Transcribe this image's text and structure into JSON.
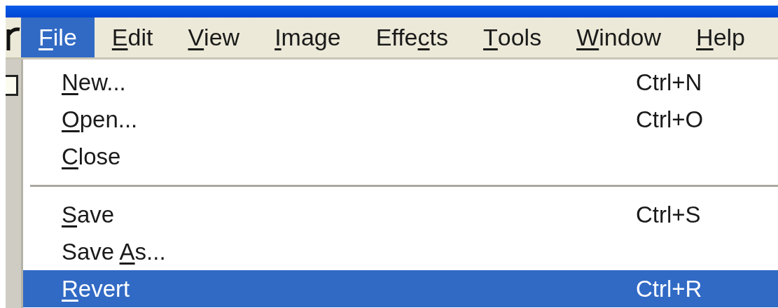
{
  "menu_bar": {
    "items": [
      {
        "key": "F",
        "after": "ile",
        "selected": true
      },
      {
        "key": "E",
        "after": "dit",
        "selected": false
      },
      {
        "key": "V",
        "after": "iew",
        "selected": false
      },
      {
        "key": "I",
        "after": "mage",
        "selected": false
      },
      {
        "before": "Effe",
        "key": "c",
        "after": "ts",
        "selected": false
      },
      {
        "key": "T",
        "after": "ools",
        "selected": false
      },
      {
        "key": "W",
        "after": "indow",
        "selected": false
      },
      {
        "key": "H",
        "after": "elp",
        "selected": false
      }
    ]
  },
  "file_menu": {
    "items": [
      {
        "kind": "item",
        "key": "N",
        "after": "ew...",
        "shortcut": "Ctrl+N",
        "selected": false
      },
      {
        "kind": "item",
        "key": "O",
        "after": "pen...",
        "shortcut": "Ctrl+O",
        "selected": false
      },
      {
        "kind": "item",
        "key": "C",
        "after": "lose",
        "selected": false
      },
      {
        "kind": "separator"
      },
      {
        "kind": "item",
        "key": "S",
        "after": "ave",
        "shortcut": "Ctrl+S",
        "selected": false
      },
      {
        "kind": "item",
        "before": "Save ",
        "key": "A",
        "after": "s...",
        "selected": false
      },
      {
        "kind": "item",
        "key": "R",
        "after": "evert",
        "shortcut": "Ctrl+R",
        "selected": true
      }
    ]
  }
}
